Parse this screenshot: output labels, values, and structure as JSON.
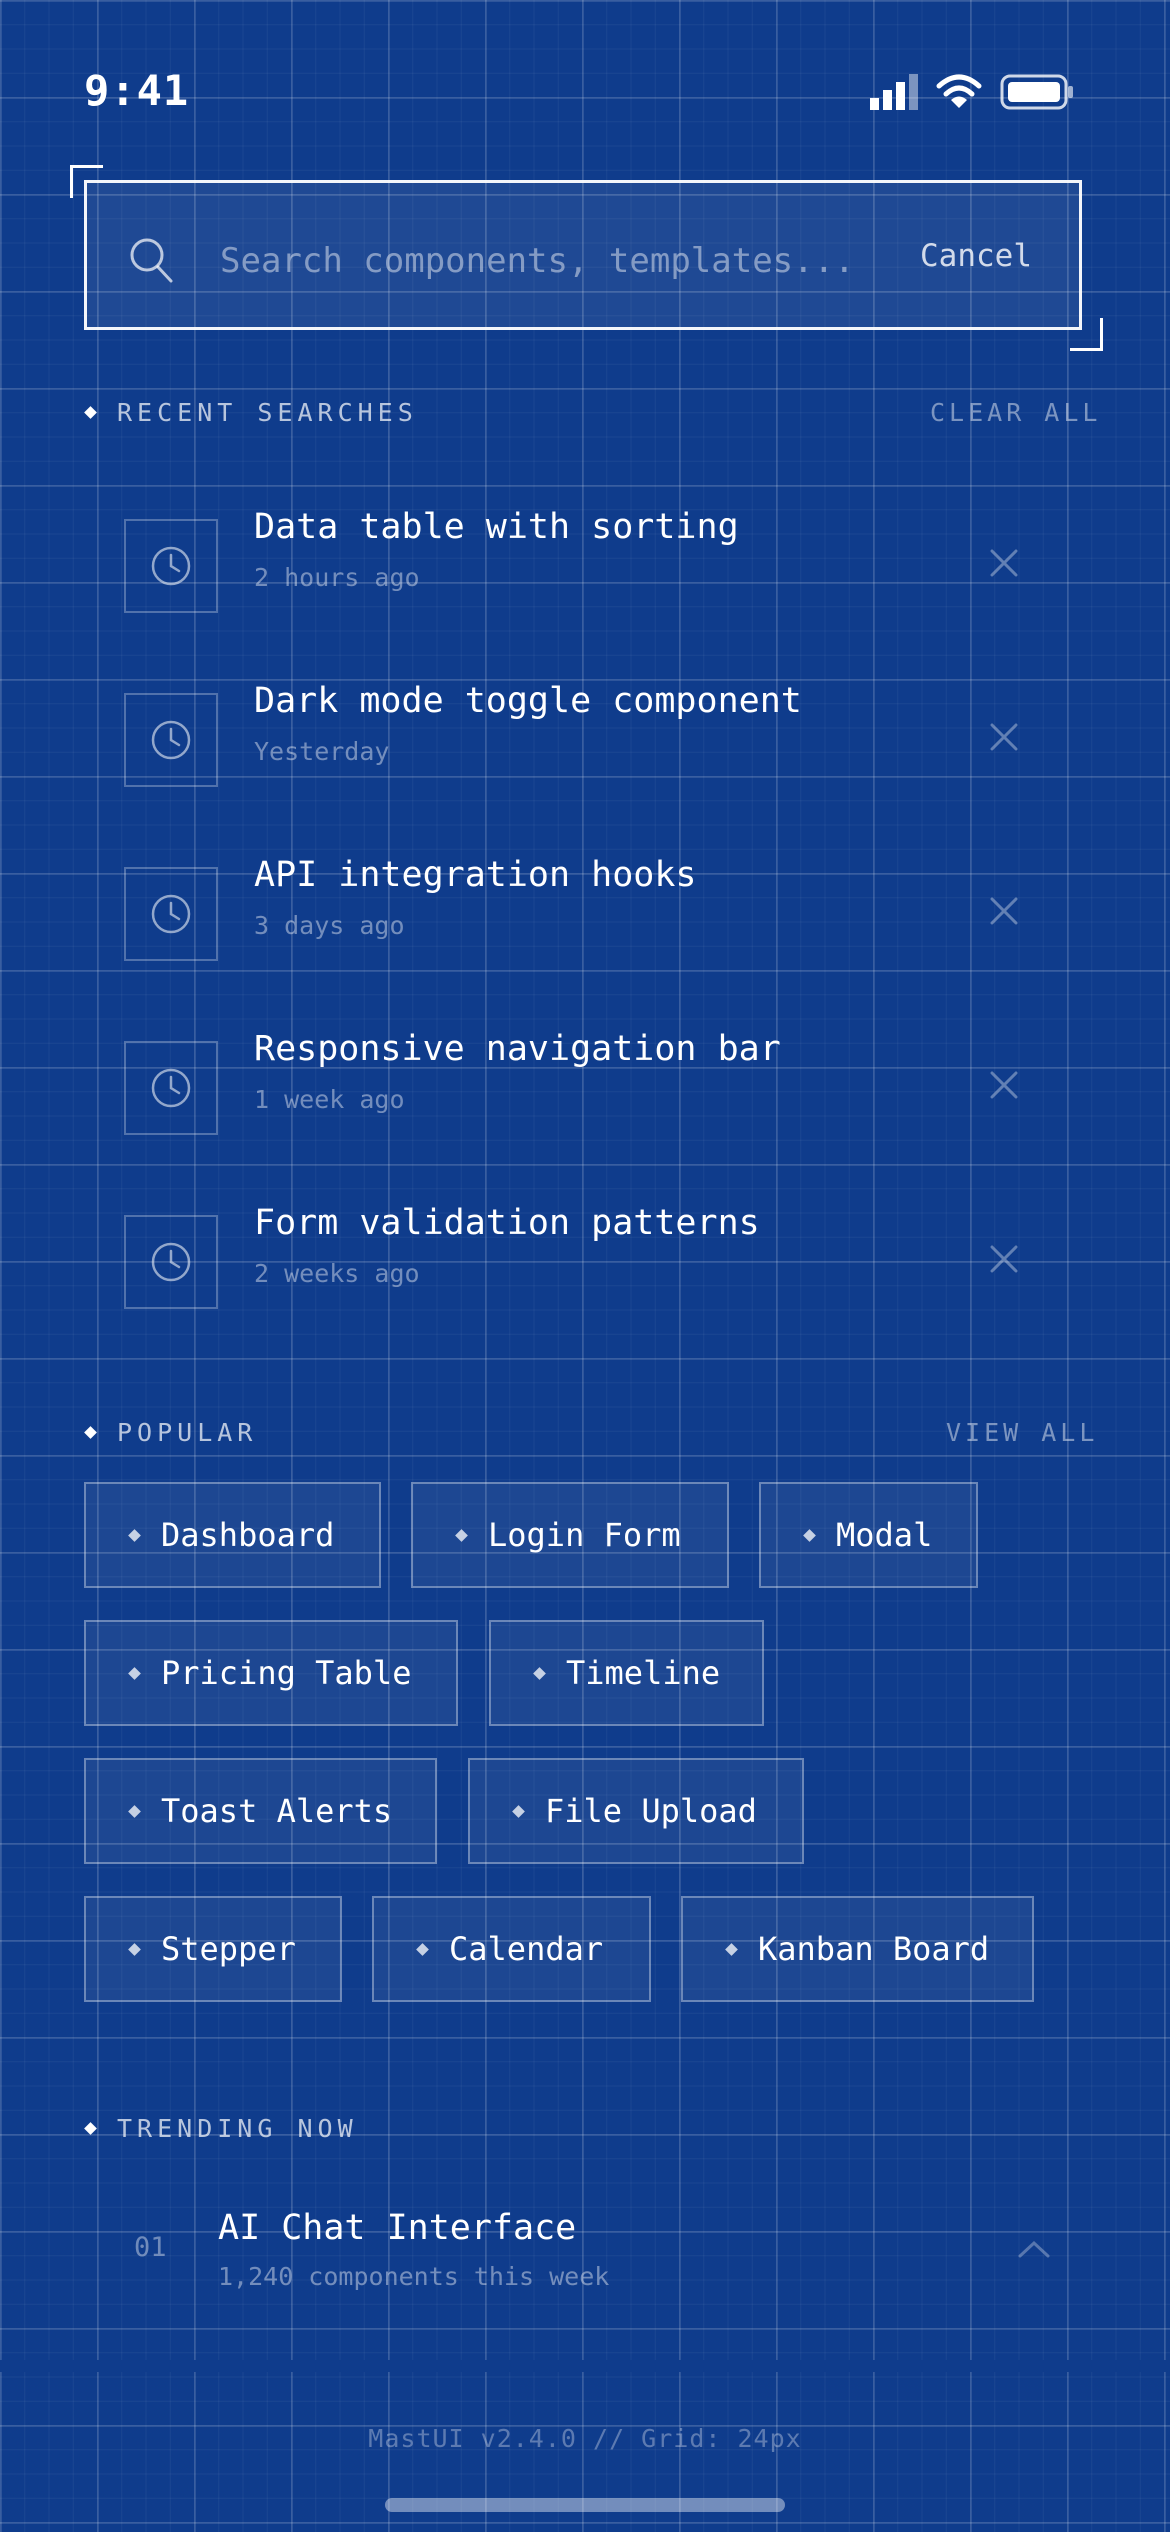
{
  "status_bar": {
    "time": "9:41"
  },
  "search": {
    "placeholder": "Search components, templates...",
    "value": "",
    "cancel_label": "Cancel"
  },
  "recent": {
    "title": "RECENT SEARCHES",
    "clear_label": "CLEAR ALL",
    "items": [
      {
        "title": "Data table with sorting",
        "time": "2 hours ago"
      },
      {
        "title": "Dark mode toggle component",
        "time": "Yesterday"
      },
      {
        "title": "API integration hooks",
        "time": "3 days ago"
      },
      {
        "title": "Responsive navigation bar",
        "time": "1 week ago"
      },
      {
        "title": "Form validation patterns",
        "time": "2 weeks ago"
      }
    ]
  },
  "popular": {
    "title": "POPULAR",
    "view_all_label": "VIEW ALL",
    "chips": [
      "Dashboard",
      "Login Form",
      "Modal",
      "Pricing Table",
      "Timeline",
      "Toast Alerts",
      "File Upload",
      "Stepper",
      "Calendar",
      "Kanban Board"
    ]
  },
  "trending": {
    "title": "TRENDING NOW",
    "items": [
      {
        "rank": "01",
        "title": "AI Chat Interface",
        "subtitle": "1,240 components this week"
      }
    ]
  },
  "footer": {
    "text": "MastUI v2.4.0 // Grid: 24px"
  },
  "colors": {
    "background": "#0f3c8c",
    "grid_line": "#ffffff"
  }
}
